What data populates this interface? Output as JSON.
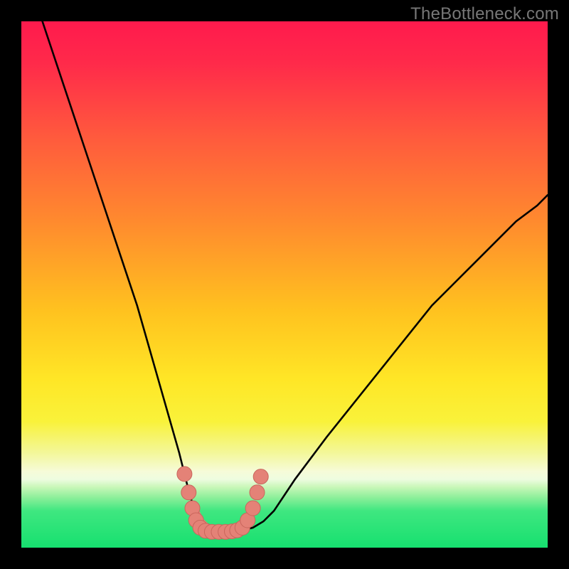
{
  "watermark": "TheBottleneck.com",
  "colors": {
    "frame": "#000000",
    "stroke": "#000000",
    "marker_fill": "#e48277",
    "marker_stroke": "#c9665c",
    "gradient_stops": [
      {
        "offset": 0.0,
        "color": "#ff1a4d"
      },
      {
        "offset": 0.08,
        "color": "#ff2a4a"
      },
      {
        "offset": 0.22,
        "color": "#ff5a3d"
      },
      {
        "offset": 0.38,
        "color": "#ff8a2e"
      },
      {
        "offset": 0.55,
        "color": "#ffc21f"
      },
      {
        "offset": 0.68,
        "color": "#ffe626"
      },
      {
        "offset": 0.76,
        "color": "#f9f23a"
      },
      {
        "offset": 0.82,
        "color": "#f3f79a"
      },
      {
        "offset": 0.855,
        "color": "#f6fbd8"
      },
      {
        "offset": 0.87,
        "color": "#eefce0"
      },
      {
        "offset": 0.885,
        "color": "#c8f7b8"
      },
      {
        "offset": 0.905,
        "color": "#8cef9a"
      },
      {
        "offset": 0.93,
        "color": "#3fe780"
      },
      {
        "offset": 1.0,
        "color": "#16e06f"
      }
    ]
  },
  "chart_data": {
    "type": "line",
    "title": "",
    "xlabel": "",
    "ylabel": "",
    "xlim": [
      0,
      100
    ],
    "ylim": [
      0,
      100
    ],
    "x": [
      4,
      6,
      8,
      10,
      12,
      14,
      16,
      18,
      20,
      22,
      24,
      26,
      28,
      30,
      31,
      32,
      33,
      34,
      35,
      36,
      37,
      38,
      39,
      40,
      42,
      44,
      46,
      48,
      50,
      52,
      55,
      58,
      62,
      66,
      70,
      74,
      78,
      82,
      86,
      90,
      94,
      98,
      100
    ],
    "values": [
      100,
      94,
      88,
      82,
      76,
      70,
      64,
      58,
      52,
      46,
      39,
      32,
      25,
      18,
      14,
      10,
      7,
      5,
      4,
      3.5,
      3.2,
      3.1,
      3.0,
      3.1,
      3.3,
      3.8,
      5.0,
      7.0,
      10,
      13,
      17,
      21,
      26,
      31,
      36,
      41,
      46,
      50,
      54,
      58,
      62,
      65,
      67
    ],
    "flat_region_x": [
      33,
      42
    ],
    "markers": [
      {
        "x": 31.0,
        "y": 14.0
      },
      {
        "x": 31.8,
        "y": 10.5
      },
      {
        "x": 32.5,
        "y": 7.5
      },
      {
        "x": 33.2,
        "y": 5.2
      },
      {
        "x": 34.0,
        "y": 3.8
      },
      {
        "x": 35.0,
        "y": 3.2
      },
      {
        "x": 36.2,
        "y": 3.0
      },
      {
        "x": 37.5,
        "y": 3.0
      },
      {
        "x": 38.8,
        "y": 3.0
      },
      {
        "x": 40.0,
        "y": 3.1
      },
      {
        "x": 41.0,
        "y": 3.3
      },
      {
        "x": 42.0,
        "y": 3.8
      },
      {
        "x": 43.0,
        "y": 5.2
      },
      {
        "x": 44.0,
        "y": 7.5
      },
      {
        "x": 44.8,
        "y": 10.5
      },
      {
        "x": 45.5,
        "y": 13.5
      }
    ]
  }
}
